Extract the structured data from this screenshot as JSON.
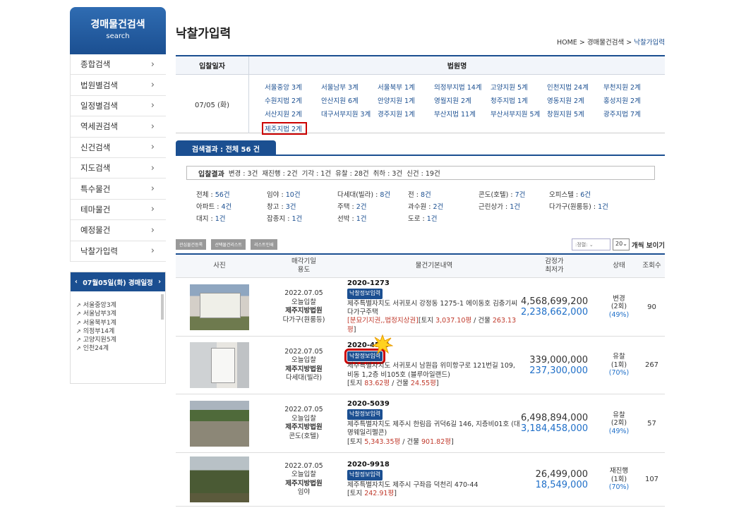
{
  "sidebar": {
    "title": "경매물건검색",
    "subtitle": "search",
    "items": [
      "종합검색",
      "법원별검색",
      "일정별검색",
      "역세권검색",
      "신건검색",
      "지도검색",
      "특수물건",
      "테마물건",
      "예정물건",
      "낙찰가입력"
    ]
  },
  "schedule": {
    "title": "07월05일(화) 경매일정",
    "items": [
      "서울중앙3계",
      "서울남부3계",
      "서울북부1계",
      "의정부14계",
      "고양지원5계",
      "인천24계"
    ]
  },
  "page": {
    "title": "낙찰가입력",
    "breadcrumb_home": "HOME",
    "breadcrumb_sep": ">",
    "breadcrumb_mid": "경매물건검색",
    "breadcrumb_cur": "낙찰가입력"
  },
  "court_table": {
    "col_date": "입찰일자",
    "col_court": "법원명",
    "date": "07/05 (화)",
    "courts": [
      "서울중앙 3계",
      "서울남부 3계",
      "서울북부 1계",
      "의정부지법 14계",
      "고양지원 5계",
      "인천지법 24계",
      "부천지원 2계",
      "수원지법 2계",
      "안산지원 6계",
      "안양지원 1계",
      "영월지원 2계",
      "청주지법 1계",
      "영동지원 2계",
      "홍성지원 2계",
      "서산지원 2계",
      "대구서부지원 3계",
      "경주지원 1계",
      "부산지법 11계",
      "부산서부지원 5계",
      "창원지원 5계",
      "광주지법 7계",
      "제주지법 2계"
    ]
  },
  "results": {
    "tab": "검색결과 : 전체 56 건",
    "label": "입찰결과",
    "stats": [
      "변경 : 3건",
      "재진행 : 2건",
      "기각 : 1건",
      "유찰 : 28건",
      "취하 : 3건",
      "신건 : 19건"
    ]
  },
  "categories": [
    {
      "k": "전체 : ",
      "v": "56건"
    },
    {
      "k": "임야 : ",
      "v": "10건"
    },
    {
      "k": "다세대(빌라) : ",
      "v": "8건"
    },
    {
      "k": "전 : ",
      "v": "8건"
    },
    {
      "k": "콘도(호텔) : ",
      "v": "7건"
    },
    {
      "k": "오피스텔 : ",
      "v": "6건"
    },
    {
      "k": "아파트 : ",
      "v": "4건"
    },
    {
      "k": "창고 : ",
      "v": "3건"
    },
    {
      "k": "주택 : ",
      "v": "2건"
    },
    {
      "k": "과수원 : ",
      "v": "2건"
    },
    {
      "k": "근린상가 : ",
      "v": "1건"
    },
    {
      "k": "다가구(원룸등) : ",
      "v": "1건"
    },
    {
      "k": "대지 : ",
      "v": "1건"
    },
    {
      "k": "잡종지 : ",
      "v": "1건"
    },
    {
      "k": "선박 : ",
      "v": "1건"
    },
    {
      "k": "도로 : ",
      "v": "1건"
    },
    {
      "k": "",
      "v": ""
    },
    {
      "k": "",
      "v": ""
    }
  ],
  "buttons": [
    "관심물건등록",
    "선택물건리스트",
    "리스트인쇄"
  ],
  "sort_placeholder": ":정렬:",
  "page_size": "20",
  "page_size_label": "개씩 보이기",
  "list_headers": {
    "photo": "사진",
    "date1": "매각기일",
    "date2": "용도",
    "desc": "물건기본내역",
    "price1": "감정가",
    "price2": "최저가",
    "state": "상태",
    "views": "조회수"
  },
  "badge": "낙찰정보입력",
  "rows": [
    {
      "date": "2022.07.05",
      "today": "오늘입찰",
      "court": "제주지방법원",
      "use": "다가구(원룸등)",
      "case": "2020-1273",
      "addr": "제주특별자치도 서귀포시 강정동 1275-1 에이동호 김충기씨다가구주택",
      "special": "[분묘기지권,,법정지상권]",
      "area_pre": "[토지 ",
      "land": "3,037.10평",
      "area_mid": " / 건물 ",
      "bldg": "263.13평",
      "area_end": "]",
      "appraisal": "4,568,699,200",
      "minimum": "2,238,662,000",
      "status": "변경",
      "round": "(2회)",
      "pct": "(49%)",
      "views": "90"
    },
    {
      "date": "2022.07.05",
      "today": "오늘입찰",
      "court": "제주지방법원",
      "use": "다세대(빌라)",
      "case": "2020-4579",
      "addr": "제주특별자치도 서귀포시 남원읍 위미항구로 121번길 109, 비동 1,2층 비105호 (블루아일랜드)",
      "special": "",
      "area_pre": "[토지 ",
      "land": "83.62평",
      "area_mid": " / 건물 ",
      "bldg": "24.55평",
      "area_end": "]",
      "appraisal": "339,000,000",
      "minimum": "237,300,000",
      "status": "유찰",
      "round": "(1회)",
      "pct": "(70%)",
      "views": "267"
    },
    {
      "date": "2022.07.05",
      "today": "오늘입찰",
      "court": "제주지방법원",
      "use": "콘도(호텔)",
      "case": "2020-5039",
      "addr": "제주특별자치도 제주시 한림읍 귀덕6길 146, 지층비01호 (대명웨일리펠콘)",
      "special": "",
      "area_pre": "[토지 ",
      "land": "5,343.35평",
      "area_mid": " / 건물 ",
      "bldg": "901.82평",
      "area_end": "]",
      "appraisal": "6,498,894,000",
      "minimum": "3,184,458,000",
      "status": "유찰",
      "round": "(2회)",
      "pct": "(49%)",
      "views": "57"
    },
    {
      "date": "2022.07.05",
      "today": "오늘입찰",
      "court": "제주지방법원",
      "use": "임야",
      "case": "2020-9918",
      "addr": "제주특별자치도 제주시 구좌읍 덕천리 470-44",
      "special": "",
      "area_pre": "[토지 ",
      "land": "242.91평",
      "area_mid": "",
      "bldg": "",
      "area_end": "]",
      "appraisal": "26,499,000",
      "minimum": "18,549,000",
      "status": "재진행",
      "round": "(1회)",
      "pct": "(70%)",
      "views": "107"
    }
  ]
}
